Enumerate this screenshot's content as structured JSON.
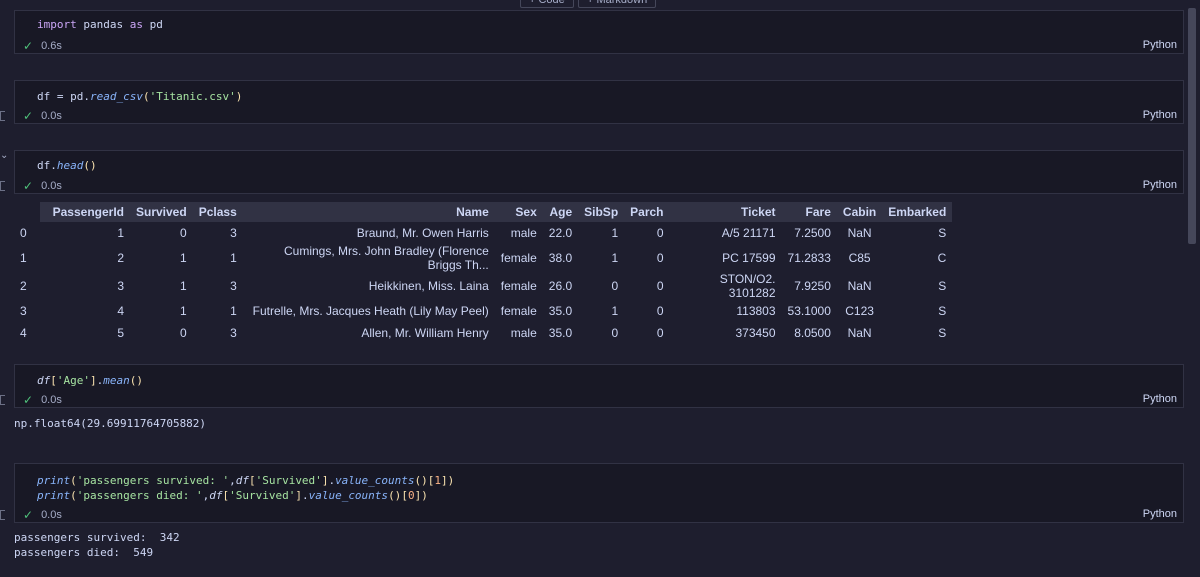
{
  "toolbar": {
    "code_label": "+ Code",
    "markdown_label": "+ Markdown"
  },
  "cells": [
    {
      "time": "0.6s",
      "lang": "Python"
    },
    {
      "time": "0.0s",
      "lang": "Python"
    },
    {
      "time": "0.0s",
      "lang": "Python"
    },
    {
      "time": "0.0s",
      "lang": "Python"
    },
    {
      "time": "0.0s",
      "lang": "Python"
    }
  ],
  "code": {
    "c1": {
      "kw1": "import",
      "mod": " pandas ",
      "kw2": "as",
      "alias": " pd"
    },
    "c2": {
      "var": "df = pd.",
      "fn": "read_csv",
      "p1": "(",
      "str": "'Titanic.csv'",
      "p2": ")"
    },
    "c3": {
      "var": "df.",
      "fn": "head",
      "p": "()"
    },
    "c4": {
      "var": "df",
      "b1": "[",
      "str": "'Age'",
      "b2": "]",
      "dot": ".",
      "fn": "mean",
      "p": "()"
    },
    "c5": {
      "line1": {
        "fn": "print",
        "p1": "(",
        "str": "'passengers survived: '",
        "comma": ",",
        "df": "df",
        "b1": "[",
        "key": "'Survived'",
        "b2": "]",
        "dot": ".",
        "vc": "value_counts",
        "p2": "()",
        "b3": "[",
        "num": "1",
        "b4": "]",
        "p3": ")"
      },
      "line2": {
        "fn": "print",
        "p1": "(",
        "str": "'passengers died: '",
        "comma": ",",
        "df": "df",
        "b1": "[",
        "key": "'Survived'",
        "b2": "]",
        "dot": ".",
        "vc": "value_counts",
        "p2": "()",
        "b3": "[",
        "num": "0",
        "b4": "]",
        "p3": ")"
      }
    }
  },
  "outputs": {
    "mean": "np.float64(29.69911764705882)",
    "survived": "passengers survived:  342",
    "died": "passengers died:  549"
  },
  "table": {
    "headers": [
      "",
      "PassengerId",
      "Survived",
      "Pclass",
      "Name",
      "Sex",
      "Age",
      "SibSp",
      "Parch",
      "Ticket",
      "Fare",
      "Cabin",
      "Embarked"
    ],
    "rows": [
      [
        "0",
        "1",
        "0",
        "3",
        "Braund, Mr. Owen Harris",
        "male",
        "22.0",
        "1",
        "0",
        "A/5 21171",
        "7.2500",
        "NaN",
        "S"
      ],
      [
        "1",
        "2",
        "1",
        "1",
        "Cumings, Mrs. John Bradley (Florence Briggs Th...",
        "female",
        "38.0",
        "1",
        "0",
        "PC 17599",
        "71.2833",
        "C85",
        "C"
      ],
      [
        "2",
        "3",
        "1",
        "3",
        "Heikkinen, Miss. Laina",
        "female",
        "26.0",
        "0",
        "0",
        "STON/O2. 3101282",
        "7.9250",
        "NaN",
        "S"
      ],
      [
        "3",
        "4",
        "1",
        "1",
        "Futrelle, Mrs. Jacques Heath (Lily May Peel)",
        "female",
        "35.0",
        "1",
        "0",
        "113803",
        "53.1000",
        "C123",
        "S"
      ],
      [
        "4",
        "5",
        "0",
        "3",
        "Allen, Mr. William Henry",
        "male",
        "35.0",
        "0",
        "0",
        "373450",
        "8.0500",
        "NaN",
        "S"
      ]
    ]
  }
}
